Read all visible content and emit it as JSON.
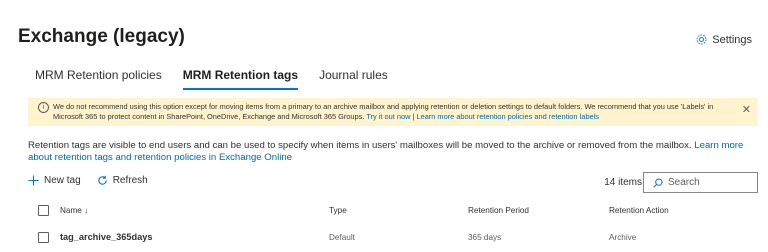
{
  "page": {
    "title": "Exchange (legacy)",
    "settings_label": "Settings"
  },
  "tabs": [
    {
      "label": "MRM Retention policies",
      "active": false
    },
    {
      "label": "MRM Retention tags",
      "active": true
    },
    {
      "label": "Journal rules",
      "active": false
    }
  ],
  "banner": {
    "text": "We do not recommend using this option except for moving items from a primary to an archive mailbox and applying retention or deletion settings to default folders. We recommend that you use 'Labels' in Microsoft 365 to protect content in SharePoint, OneDrive, Exchange and Microsoft 365 Groups.",
    "link1": "Try it out now",
    "separator": "|",
    "link2": "Learn more about retention policies and retention labels",
    "close_glyph": "✕"
  },
  "description": {
    "text": "Retention tags are visible to end users and can be used to specify when items in users' mailboxes will be moved to the archive or removed from the mailbox.",
    "link": "Learn more about retention tags and retention policies in Exchange Online"
  },
  "toolbar": {
    "new_tag": "New tag",
    "refresh": "Refresh",
    "count": "14 items",
    "search_placeholder": "Search"
  },
  "table": {
    "columns": {
      "name": "Name ↓",
      "type": "Type",
      "period": "Retention Period",
      "action": "Retention Action"
    },
    "rows": [
      {
        "name": "tag_archive_365days",
        "type": "Default",
        "period": "365 days",
        "action": "Archive"
      }
    ]
  },
  "colors": {
    "accent": "#0078d4",
    "banner_bg": "#fff4ce",
    "link": "#0067b8"
  }
}
